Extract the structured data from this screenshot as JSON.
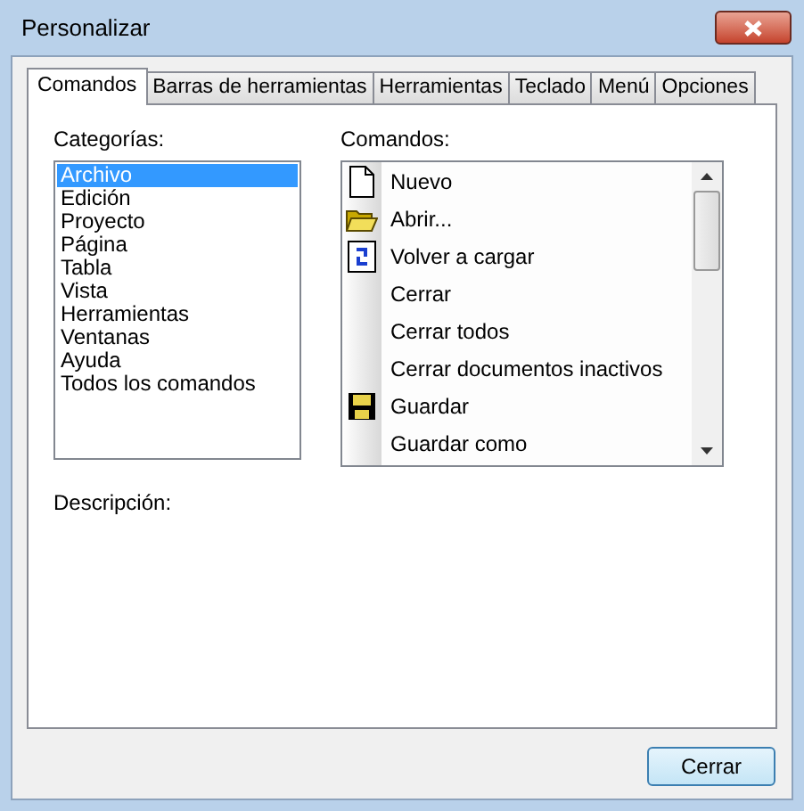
{
  "window": {
    "title": "Personalizar"
  },
  "tabs": [
    {
      "label": "Comandos",
      "selected": true
    },
    {
      "label": "Barras de herramientas",
      "selected": false
    },
    {
      "label": "Herramientas",
      "selected": false
    },
    {
      "label": "Teclado",
      "selected": false
    },
    {
      "label": "Menú",
      "selected": false
    },
    {
      "label": "Opciones",
      "selected": false
    }
  ],
  "categories": {
    "label": "Categorías:",
    "items": [
      {
        "label": "Archivo",
        "selected": true
      },
      {
        "label": "Edición",
        "selected": false
      },
      {
        "label": "Proyecto",
        "selected": false
      },
      {
        "label": "Página",
        "selected": false
      },
      {
        "label": "Tabla",
        "selected": false
      },
      {
        "label": "Vista",
        "selected": false
      },
      {
        "label": "Herramientas",
        "selected": false
      },
      {
        "label": "Ventanas",
        "selected": false
      },
      {
        "label": "Ayuda",
        "selected": false
      },
      {
        "label": "Todos los comandos",
        "selected": false
      }
    ]
  },
  "commands": {
    "label": "Comandos:",
    "items": [
      {
        "label": "Nuevo",
        "kind": "document"
      },
      {
        "label": "Abrir...",
        "kind": "folder"
      },
      {
        "label": "Volver a cargar",
        "kind": "reload"
      },
      {
        "label": "Cerrar",
        "kind": "plain"
      },
      {
        "label": "Cerrar todos",
        "kind": "plain"
      },
      {
        "label": "Cerrar documentos inactivos",
        "kind": "plain"
      },
      {
        "label": "Guardar",
        "kind": "floppy"
      },
      {
        "label": "Guardar como",
        "kind": "plain"
      }
    ]
  },
  "description": {
    "label": "Descripción:"
  },
  "buttons": [
    "Cerrar"
  ]
}
